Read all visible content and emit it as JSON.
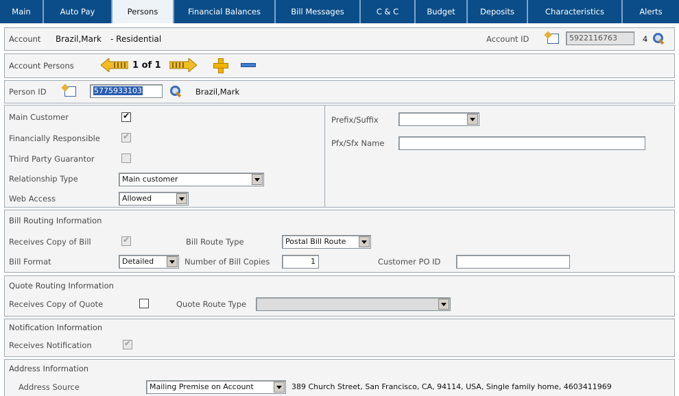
{
  "tabs": [
    {
      "label": "Main"
    },
    {
      "label": "Auto Pay"
    },
    {
      "label": "Persons",
      "active": true
    },
    {
      "label": "Financial Balances"
    },
    {
      "label": "Bill Messages"
    },
    {
      "label": "C & C"
    },
    {
      "label": "Budget"
    },
    {
      "label": "Deposits"
    },
    {
      "label": "Characteristics"
    },
    {
      "label": "Alerts"
    }
  ],
  "account": {
    "label": "Account",
    "name": "Brazil,Mark",
    "type": "- Residential",
    "id_label": "Account ID",
    "id_value": "5922116763",
    "check_digit": "4"
  },
  "account_persons": {
    "label": "Account Persons",
    "pager": "1 of 1"
  },
  "person": {
    "id_label": "Person ID",
    "id_value": "5775933103",
    "name": "Brazil,Mark"
  },
  "details": {
    "main_customer_label": "Main Customer",
    "main_customer": true,
    "fin_resp_label": "Financially Responsible",
    "fin_resp": true,
    "third_party_label": "Third Party Guarantor",
    "third_party": false,
    "relationship_label": "Relationship Type",
    "relationship_value": "Main customer",
    "web_access_label": "Web Access",
    "web_access_value": "Allowed",
    "prefix_label": "Prefix/Suffix",
    "prefix_value": "",
    "pfx_name_label": "Pfx/Sfx Name",
    "pfx_name_value": ""
  },
  "bill_routing": {
    "title": "Bill Routing Information",
    "receives_copy_label": "Receives Copy of Bill",
    "receives_copy": true,
    "route_type_label": "Bill Route Type",
    "route_type_value": "Postal Bill Route",
    "format_label": "Bill Format",
    "format_value": "Detailed",
    "copies_label": "Number of Bill Copies",
    "copies_value": "1",
    "po_label": "Customer PO ID",
    "po_value": ""
  },
  "quote_routing": {
    "title": "Quote Routing Information",
    "receives_copy_label": "Receives Copy of Quote",
    "receives_copy": false,
    "route_type_label": "Quote Route Type",
    "route_type_value": ""
  },
  "notification": {
    "title": "Notification Information",
    "receives_label": "Receives Notification",
    "receives": true
  },
  "address": {
    "title": "Address Information",
    "source_label": "Address Source",
    "source_value": "Mailing Premise on Account",
    "address_text": "389 Church Street, San Francisco, CA, 94114, USA, Single family home, 4603411969"
  },
  "colors": {
    "tabbar": "#0a4d88",
    "section_bg": "#f4f4f4",
    "border": "#9fa9b2"
  },
  "icons": [
    "id-card-icon",
    "search-icon",
    "prev-arrow-icon",
    "next-arrow-icon",
    "add-icon",
    "remove-icon",
    "dropdown-arrow-icon",
    "checkbox-icon"
  ]
}
